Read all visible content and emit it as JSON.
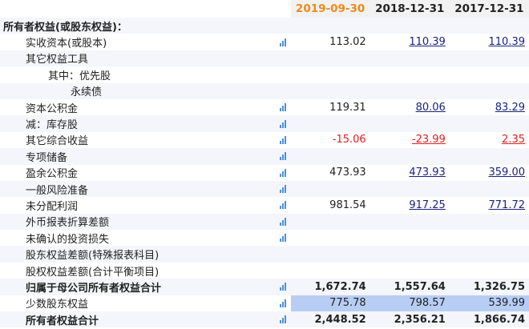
{
  "headers": [
    "2019-09-30",
    "2018-12-31",
    "2017-12-31"
  ],
  "rows": [
    {
      "label": "所有者权益(或股东权益)：",
      "indent": 0,
      "type": "section",
      "icon": false,
      "values": [
        "",
        "",
        ""
      ]
    },
    {
      "label": "实收资本(或股本)",
      "indent": 1,
      "icon": true,
      "values": [
        "113.02",
        "110.39",
        "110.39"
      ]
    },
    {
      "label": "其它权益工具",
      "indent": 1,
      "icon": false,
      "values": [
        "",
        "",
        ""
      ]
    },
    {
      "label": "其中：优先股",
      "indent": 2,
      "icon": false,
      "values": [
        "",
        "",
        ""
      ]
    },
    {
      "label": "永续债",
      "indent": 3,
      "icon": false,
      "values": [
        "",
        "",
        ""
      ]
    },
    {
      "label": "资本公积金",
      "indent": 1,
      "icon": true,
      "values": [
        "119.31",
        "80.06",
        "83.29"
      ]
    },
    {
      "label": "减：库存股",
      "indent": 1,
      "icon": true,
      "values": [
        "",
        "",
        ""
      ]
    },
    {
      "label": "其它综合收益",
      "indent": 1,
      "icon": true,
      "negative": true,
      "values": [
        "-15.06",
        "-23.99",
        "2.35"
      ]
    },
    {
      "label": "专项储备",
      "indent": 1,
      "icon": true,
      "values": [
        "",
        "",
        ""
      ]
    },
    {
      "label": "盈余公积金",
      "indent": 1,
      "icon": true,
      "values": [
        "473.93",
        "473.93",
        "359.00"
      ]
    },
    {
      "label": "一般风险准备",
      "indent": 1,
      "icon": true,
      "values": [
        "",
        "",
        ""
      ]
    },
    {
      "label": "未分配利润",
      "indent": 1,
      "icon": true,
      "values": [
        "981.54",
        "917.25",
        "771.72"
      ]
    },
    {
      "label": "外币报表折算差额",
      "indent": 1,
      "icon": true,
      "values": [
        "",
        "",
        ""
      ]
    },
    {
      "label": "未确认的投资损失",
      "indent": 1,
      "icon": true,
      "values": [
        "",
        "",
        ""
      ]
    },
    {
      "label": "股东权益差额(特殊报表科目)",
      "indent": 1,
      "icon": false,
      "values": [
        "",
        "",
        ""
      ]
    },
    {
      "label": "股权权益差额(合计平衡项目)",
      "indent": 1,
      "icon": false,
      "values": [
        "",
        "",
        ""
      ]
    },
    {
      "label": "归属于母公司所有者权益合计",
      "indent": 1,
      "type": "total",
      "icon": true,
      "values": [
        "1,672.74",
        "1,557.64",
        "1,326.75"
      ]
    },
    {
      "label": "少数股东权益",
      "indent": 1,
      "icon": true,
      "highlight": true,
      "values": [
        "775.78",
        "798.57",
        "539.99"
      ]
    },
    {
      "label": "所有者权益合计",
      "indent": 1,
      "type": "total",
      "icon": true,
      "values": [
        "2,448.52",
        "2,356.21",
        "1,866.74"
      ]
    }
  ]
}
